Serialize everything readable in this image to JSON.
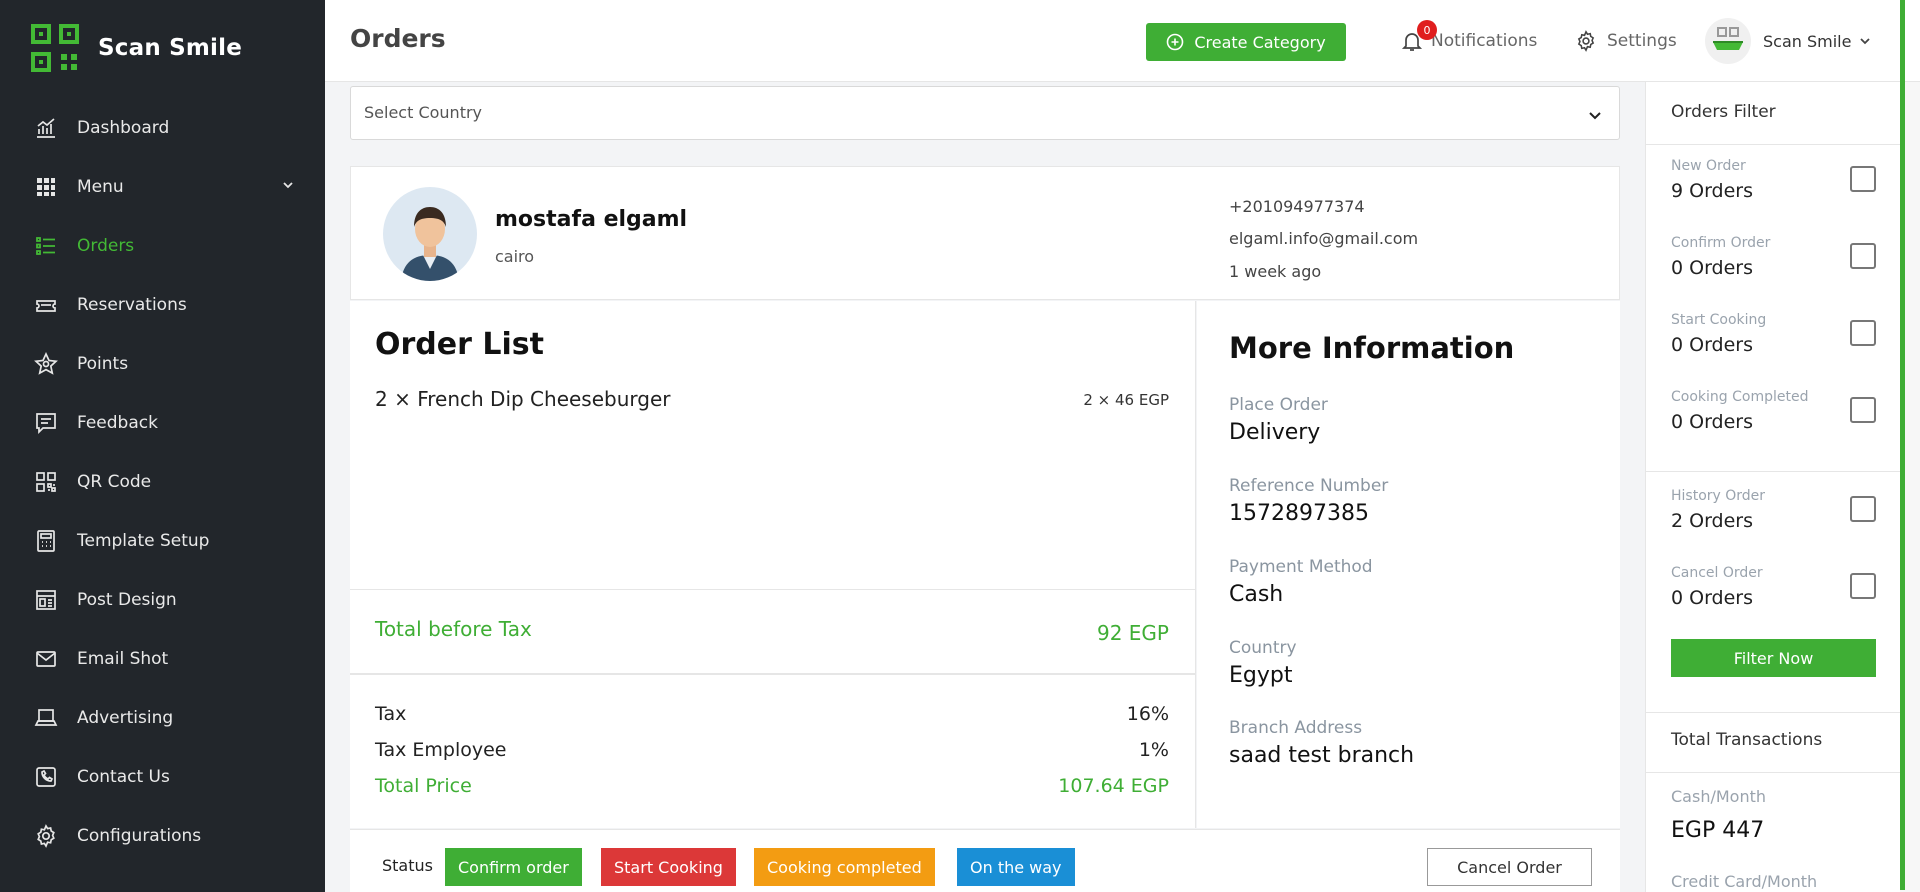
{
  "brand": {
    "name": "Scan Smile"
  },
  "sidebar": {
    "items": [
      {
        "label": "Dashboard",
        "icon": "chart-icon"
      },
      {
        "label": "Menu",
        "icon": "grid-icon"
      },
      {
        "label": "Orders",
        "icon": "list-icon"
      },
      {
        "label": "Reservations",
        "icon": "ticket-icon"
      },
      {
        "label": "Points",
        "icon": "star-icon"
      },
      {
        "label": "Feedback",
        "icon": "message-icon"
      },
      {
        "label": "QR Code",
        "icon": "qr-icon"
      },
      {
        "label": "Template Setup",
        "icon": "calculator-icon"
      },
      {
        "label": "Post Design",
        "icon": "layout-icon"
      },
      {
        "label": "Email Shot",
        "icon": "mail-icon"
      },
      {
        "label": "Advertising",
        "icon": "laptop-icon"
      },
      {
        "label": "Contact Us",
        "icon": "phone-icon"
      },
      {
        "label": "Configurations",
        "icon": "gear-icon"
      }
    ],
    "active_index": 2
  },
  "header": {
    "title": "Orders",
    "create_label": "Create Category",
    "notifications_label": "Notifications",
    "notifications_count": "0",
    "settings_label": "Settings",
    "user_name": "Scan Smile"
  },
  "country": {
    "placeholder": "Select Country"
  },
  "customer": {
    "name": "mostafa elgaml",
    "city": "cairo",
    "phone": "+201094977374",
    "email": "elgaml.info@gmail.com",
    "time": "1 week ago"
  },
  "order_list": {
    "title": "Order List",
    "items": [
      {
        "text": "2 × French Dip Cheeseburger",
        "price": "2 × 46 EGP"
      }
    ],
    "total_before_tax_label": "Total before Tax",
    "total_before_tax": "92 EGP",
    "tax_label": "Tax",
    "tax": "16%",
    "tax_employee_label": "Tax Employee",
    "tax_employee": "1%",
    "total_price_label": "Total Price",
    "total_price": "107.64 EGP"
  },
  "more_info": {
    "title": "More Information",
    "fields": [
      {
        "label": "Place Order",
        "value": "Delivery"
      },
      {
        "label": "Reference Number",
        "value": "1572897385"
      },
      {
        "label": "Payment Method",
        "value": "Cash"
      },
      {
        "label": "Country",
        "value": "Egypt"
      },
      {
        "label": "Branch Address",
        "value": "saad test branch"
      }
    ]
  },
  "status": {
    "label": "Status",
    "confirm": "Confirm order",
    "start": "Start Cooking",
    "completed": "Cooking completed",
    "on_way": "On the way",
    "cancel": "Cancel Order"
  },
  "filter": {
    "title": "Orders Filter",
    "rows": [
      {
        "label": "New Order",
        "value": "9 Orders"
      },
      {
        "label": "Confirm Order",
        "value": "0 Orders"
      },
      {
        "label": "Start Cooking",
        "value": "0 Orders"
      },
      {
        "label": "Cooking Completed",
        "value": "0 Orders"
      },
      {
        "label": "History Order",
        "value": "2 Orders"
      },
      {
        "label": "Cancel Order",
        "value": "0 Orders"
      }
    ],
    "button": "Filter Now",
    "transactions_title": "Total Transactions",
    "cash_month_label": "Cash/Month",
    "cash_month_value": "EGP 447",
    "card_month_label": "Credit Card/Month"
  },
  "colors": {
    "accent": "#3fae35",
    "sidebar_bg": "#22262b",
    "danger": "#dc3838",
    "warning": "#f39c12",
    "info": "#1a8fd6"
  }
}
